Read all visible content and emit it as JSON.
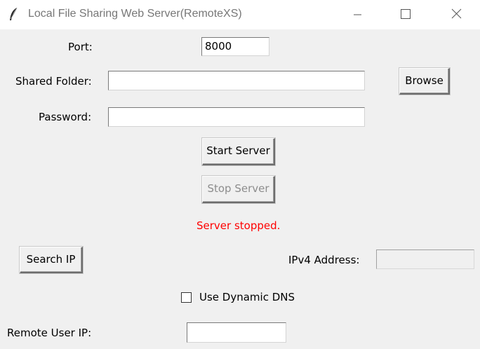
{
  "window": {
    "title": "Local File Sharing Web Server(RemoteXS)",
    "icon": "feather-icon",
    "controls": [
      "minimize-icon",
      "maximize-icon",
      "close-icon"
    ]
  },
  "form": {
    "port_label": "Port:",
    "port_value": "8000",
    "shared_folder_label": "Shared Folder:",
    "shared_folder_value": "",
    "browse_label": "Browse",
    "password_label": "Password:",
    "password_value": ""
  },
  "server": {
    "start_label": "Start Server",
    "stop_label": "Stop Server",
    "status_text": "Server stopped.",
    "status_color": "#ff0000"
  },
  "network": {
    "search_ip_label": "Search IP",
    "ipv4_label": "IPv4 Address:",
    "ipv4_value": "",
    "dynamic_dns_label": "Use Dynamic DNS",
    "dynamic_dns_checked": false,
    "remote_user_ip_label": "Remote User IP:",
    "remote_user_ip_value": ""
  }
}
